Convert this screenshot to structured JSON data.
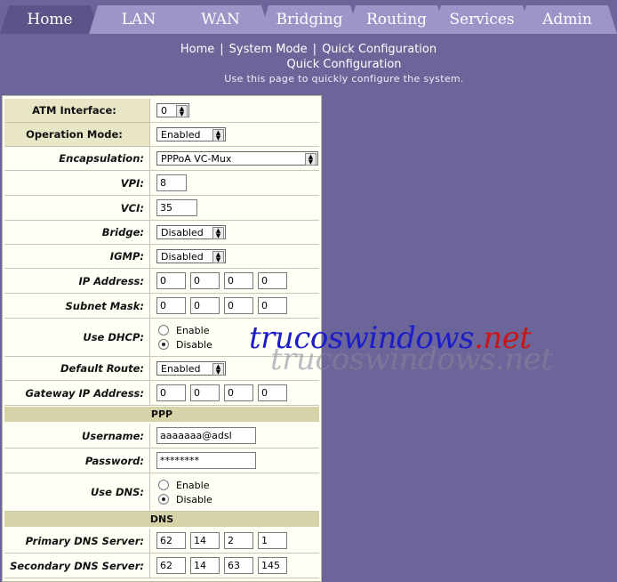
{
  "tabs": [
    "Home",
    "LAN",
    "WAN",
    "Bridging",
    "Routing",
    "Services",
    "Admin"
  ],
  "active_tab": "Home",
  "breadcrumb": [
    "Home",
    "System Mode",
    "Quick Configuration"
  ],
  "page_title": "Quick Configuration",
  "page_subtitle": "Use this page to quickly configure the system.",
  "form": {
    "atm_interface": {
      "label": "ATM Interface:",
      "value": "0"
    },
    "operation_mode": {
      "label": "Operation Mode:",
      "value": "Enabled"
    },
    "encapsulation": {
      "label": "Encapsulation:",
      "value": "PPPoA VC-Mux"
    },
    "vpi": {
      "label": "VPI:",
      "value": "8"
    },
    "vci": {
      "label": "VCI:",
      "value": "35"
    },
    "bridge": {
      "label": "Bridge:",
      "value": "Disabled"
    },
    "igmp": {
      "label": "IGMP:",
      "value": "Disabled"
    },
    "ip_address": {
      "label": "IP Address:",
      "octets": [
        "0",
        "0",
        "0",
        "0"
      ]
    },
    "subnet_mask": {
      "label": "Subnet Mask:",
      "octets": [
        "0",
        "0",
        "0",
        "0"
      ]
    },
    "use_dhcp": {
      "label": "Use DHCP:",
      "enable": "Enable",
      "disable": "Disable",
      "selected": "Disable"
    },
    "default_route": {
      "label": "Default Route:",
      "value": "Enabled"
    },
    "gateway_ip": {
      "label": "Gateway IP Address:",
      "octets": [
        "0",
        "0",
        "0",
        "0"
      ]
    },
    "ppp_section": "PPP",
    "username": {
      "label": "Username:",
      "value": "aaaaaaa@adsl"
    },
    "password": {
      "label": "Password:",
      "value": "********"
    },
    "use_dns": {
      "label": "Use DNS:",
      "enable": "Enable",
      "disable": "Disable",
      "selected": "Disable"
    },
    "dns_section": "DNS",
    "primary_dns": {
      "label": "Primary DNS Server:",
      "octets": [
        "62",
        "14",
        "2",
        "1"
      ]
    },
    "secondary_dns": {
      "label": "Secondary DNS Server:",
      "octets": [
        "62",
        "14",
        "63",
        "145"
      ]
    }
  },
  "watermark": {
    "main": "trucoswindows",
    "ext": ".net",
    "shadow": "trucoswindows.net"
  },
  "colors": {
    "background": "#6b6599",
    "tab": "#9c95c8",
    "active_tab": "#5a5489",
    "section_header": "#d6d3a8"
  }
}
